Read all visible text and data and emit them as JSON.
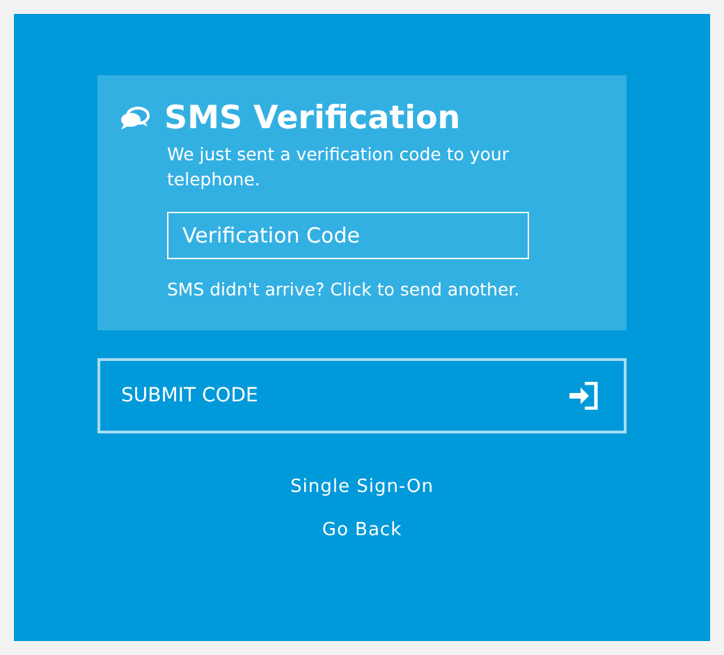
{
  "card": {
    "title": "SMS Verification",
    "message": "We just sent a verification code to your telephone.",
    "code_field": {
      "placeholder": "Verification Code"
    },
    "resend_link": "SMS didn't arrive? Click to send another."
  },
  "submit_button": {
    "label": "SUBMIT CODE"
  },
  "links": [
    "Single Sign-On",
    "Go Back"
  ]
}
